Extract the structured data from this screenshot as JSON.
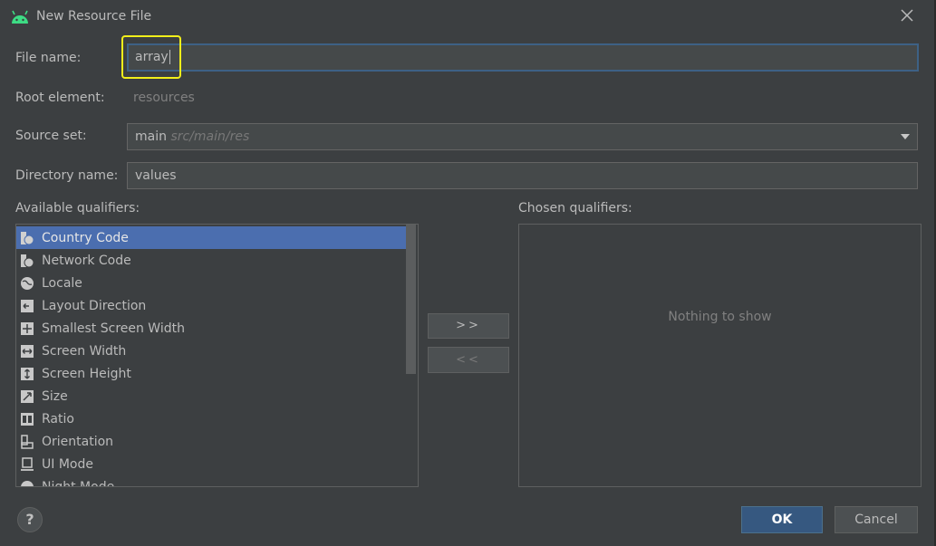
{
  "window": {
    "title": "New Resource File",
    "app_icon": "android-icon",
    "close_icon": "close-icon"
  },
  "form": {
    "file_name": {
      "label": "File name:",
      "value": "array"
    },
    "root_element": {
      "label": "Root element:",
      "value": "resources"
    },
    "source_set": {
      "label": "Source set:",
      "value": "main",
      "hint": "src/main/res"
    },
    "directory_name": {
      "label": "Directory name:",
      "value": "values"
    }
  },
  "qualifiers": {
    "available_label": "Available qualifiers:",
    "chosen_label": "Chosen qualifiers:",
    "chosen_empty": "Nothing to show",
    "add_button": ">>",
    "remove_button": "<<",
    "items": [
      {
        "label": "Country Code",
        "icon": "country-code-icon",
        "selected": true
      },
      {
        "label": "Network Code",
        "icon": "network-code-icon"
      },
      {
        "label": "Locale",
        "icon": "globe-icon"
      },
      {
        "label": "Layout Direction",
        "icon": "layout-direction-icon"
      },
      {
        "label": "Smallest Screen Width",
        "icon": "smallest-width-icon"
      },
      {
        "label": "Screen Width",
        "icon": "screen-width-icon"
      },
      {
        "label": "Screen Height",
        "icon": "screen-height-icon"
      },
      {
        "label": "Size",
        "icon": "size-icon"
      },
      {
        "label": "Ratio",
        "icon": "ratio-icon"
      },
      {
        "label": "Orientation",
        "icon": "orientation-icon"
      },
      {
        "label": "UI Mode",
        "icon": "ui-mode-icon"
      },
      {
        "label": "Night Mode",
        "icon": "night-mode-icon"
      }
    ]
  },
  "footer": {
    "help": "?",
    "ok": "OK",
    "cancel": "Cancel"
  },
  "colors": {
    "background": "#3c3f41",
    "selection": "#4b6eaf",
    "ok_button": "#365880",
    "highlight": "#f2ef1a"
  }
}
